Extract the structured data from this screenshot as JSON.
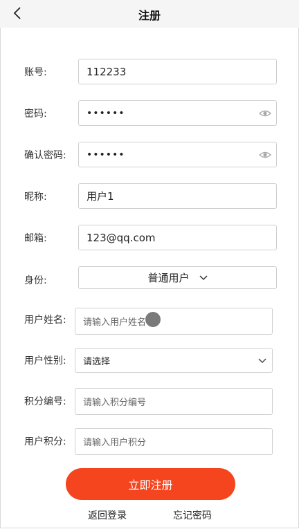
{
  "header": {
    "title": "注册",
    "back_icon": "chevron-left-icon"
  },
  "form": {
    "account": {
      "label": "账号:",
      "value": "112233"
    },
    "password": {
      "label": "密码:",
      "value": "••••••",
      "icon": "eye-icon"
    },
    "confirm_password": {
      "label": "确认密码:",
      "value": "••••••",
      "icon": "eye-icon"
    },
    "nickname": {
      "label": "昵称:",
      "value": "用户1"
    },
    "email": {
      "label": "邮箱:",
      "value": "123@qq.com"
    },
    "identity": {
      "label": "身份:",
      "selected": "普通用户"
    },
    "user_name": {
      "label": "用户姓名:",
      "placeholder": "请输入用户姓名"
    },
    "user_gender": {
      "label": "用户性别:",
      "selected": "请选择"
    },
    "points_code": {
      "label": "积分编号:",
      "placeholder": "请输入积分编号"
    },
    "user_points": {
      "label": "用户积分:",
      "placeholder": "请输入用户积分"
    }
  },
  "actions": {
    "register": "立即注册",
    "back_login": "返回登录",
    "forgot_password": "忘记密码"
  },
  "colors": {
    "primary": "#f5451f",
    "header_bg": "#f5f5f5",
    "border": "#cfcfcf"
  }
}
